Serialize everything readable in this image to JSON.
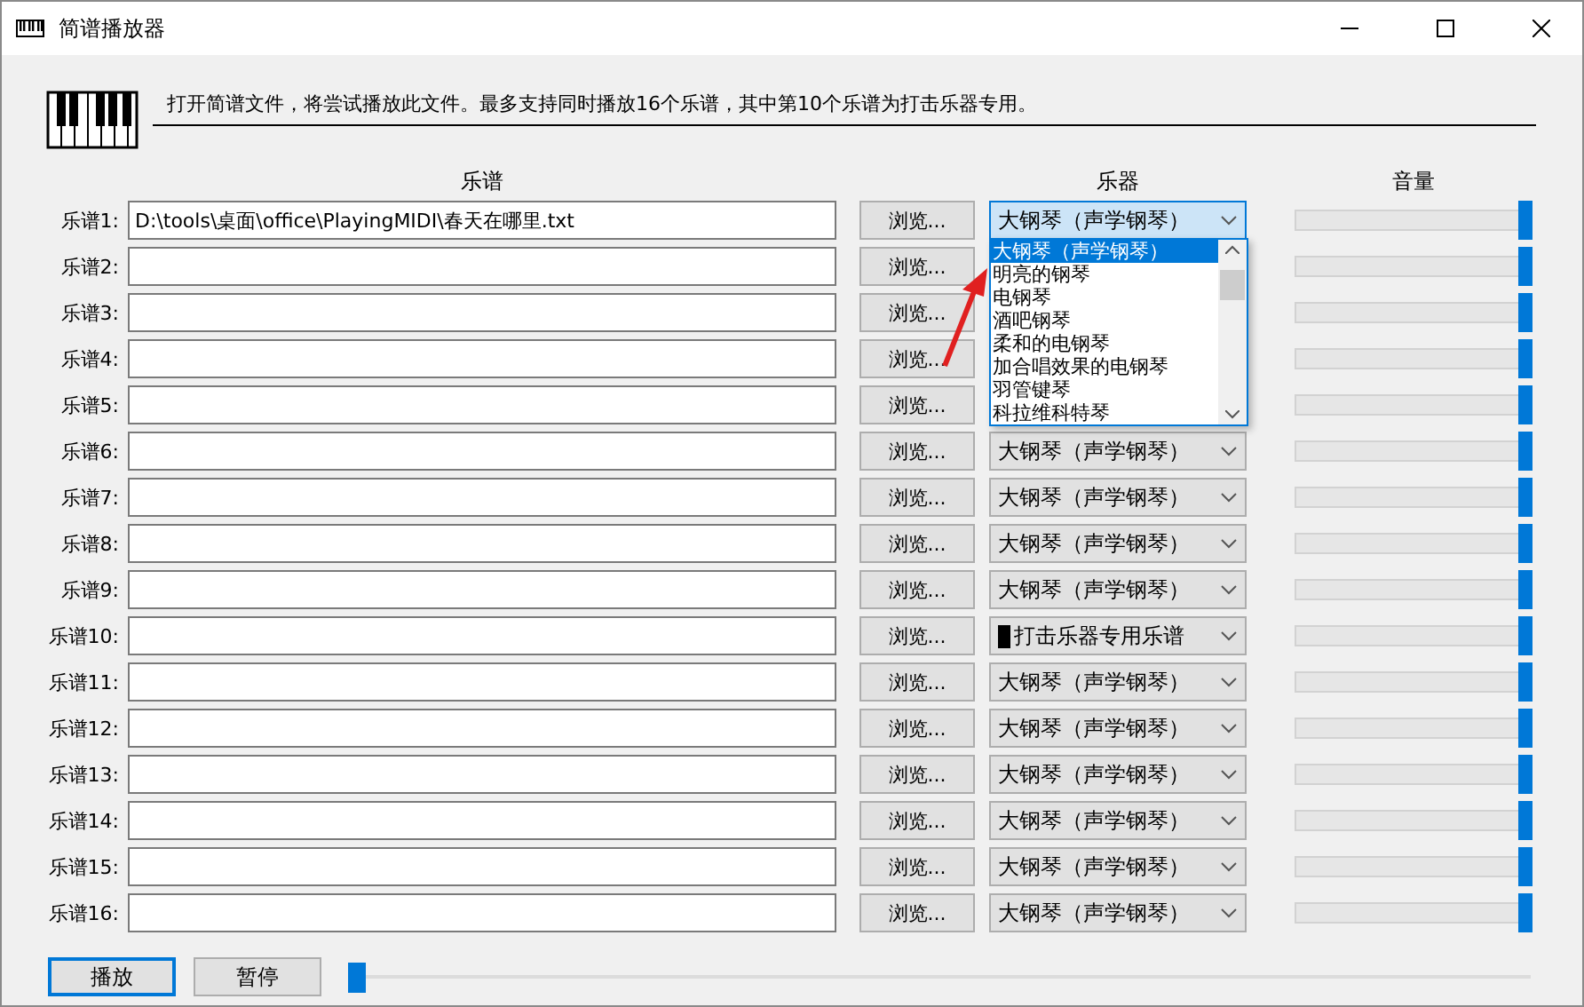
{
  "window": {
    "title": "简谱播放器"
  },
  "intro": "打开简谱文件，将尝试播放此文件。最多支持同时播放16个乐谱，其中第10个乐谱为打击乐器专用。",
  "columns": [
    "乐谱",
    "乐器",
    "音量"
  ],
  "rows": [
    {
      "label": "乐谱1:",
      "path": "D:\\tools\\桌面\\office\\PlayingMIDI\\春天在哪里.txt",
      "browse": "浏览...",
      "instrument": "大钢琴（声学钢琴）",
      "kind": "melodic",
      "open": true,
      "level": 1
    },
    {
      "label": "乐谱2:",
      "browse": "浏览...",
      "level": 1
    },
    {
      "label": "乐谱3:",
      "browse": "浏览...",
      "level": 1
    },
    {
      "label": "乐谱4:",
      "browse": "浏览...",
      "level": 1
    },
    {
      "label": "乐谱5:",
      "browse": "浏览...",
      "level": 1
    },
    {
      "label": "乐谱6:",
      "browse": "浏览...",
      "instrument": "大钢琴（声学钢琴）",
      "kind": "melodic",
      "open": false,
      "level": 1
    },
    {
      "label": "乐谱7:",
      "browse": "浏览...",
      "instrument": "大钢琴（声学钢琴）",
      "kind": "melodic",
      "open": false,
      "level": 1
    },
    {
      "label": "乐谱8:",
      "browse": "浏览...",
      "instrument": "大钢琴（声学钢琴）",
      "kind": "melodic",
      "open": false,
      "level": 1
    },
    {
      "label": "乐谱9:",
      "browse": "浏览...",
      "instrument": "大钢琴（声学钢琴）",
      "kind": "melodic",
      "open": false,
      "level": 1
    },
    {
      "label": "乐谱10:",
      "browse": "浏览...",
      "instrument": "打击乐器专用乐谱",
      "kind": "percussion",
      "open": false,
      "level": 1
    },
    {
      "label": "乐谱11:",
      "browse": "浏览...",
      "instrument": "大钢琴（声学钢琴）",
      "kind": "melodic",
      "open": false,
      "level": 1
    },
    {
      "label": "乐谱12:",
      "browse": "浏览...",
      "instrument": "大钢琴（声学钢琴）",
      "kind": "melodic",
      "open": false,
      "level": 1
    },
    {
      "label": "乐谱13:",
      "browse": "浏览...",
      "instrument": "大钢琴（声学钢琴）",
      "kind": "melodic",
      "open": false,
      "level": 1
    },
    {
      "label": "乐谱14:",
      "browse": "浏览...",
      "instrument": "大钢琴（声学钢琴）",
      "kind": "melodic",
      "open": false,
      "level": 1
    },
    {
      "label": "乐谱15:",
      "browse": "浏览...",
      "instrument": "大钢琴（声学钢琴）",
      "kind": "melodic",
      "open": false,
      "level": 1
    },
    {
      "label": "乐谱16:",
      "browse": "浏览...",
      "instrument": "大钢琴（声学钢琴）",
      "kind": "melodic",
      "open": false,
      "level": 1
    }
  ],
  "dropdown": {
    "items": [
      {
        "label": "大钢琴（声学钢琴）",
        "selected": true
      },
      {
        "label": "明亮的钢琴",
        "selected": false
      },
      {
        "label": "电钢琴",
        "selected": false
      },
      {
        "label": "酒吧钢琴",
        "selected": false
      },
      {
        "label": "柔和的电钢琴",
        "selected": false
      },
      {
        "label": "加合唱效果的电钢琴",
        "selected": false
      },
      {
        "label": "羽管键琴",
        "selected": false
      },
      {
        "label": "科拉维科特琴",
        "selected": false
      }
    ]
  },
  "buttons": [
    {
      "label": "播放",
      "focused": true
    },
    {
      "label": "暂停",
      "focused": false
    }
  ],
  "progress": {
    "level": 0
  }
}
